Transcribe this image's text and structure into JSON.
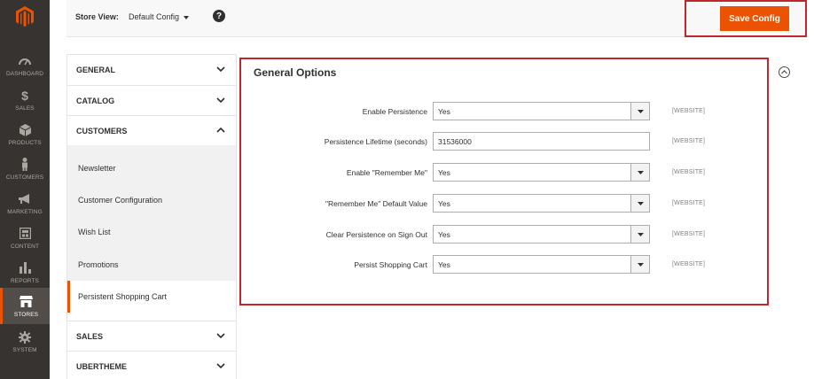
{
  "nav": {
    "items": [
      {
        "label": "DASHBOARD",
        "icon": "dashboard-icon"
      },
      {
        "label": "SALES",
        "icon": "dollar-icon"
      },
      {
        "label": "PRODUCTS",
        "icon": "cube-icon"
      },
      {
        "label": "CUSTOMERS",
        "icon": "person-icon"
      },
      {
        "label": "MARKETING",
        "icon": "megaphone-icon"
      },
      {
        "label": "CONTENT",
        "icon": "content-icon"
      },
      {
        "label": "REPORTS",
        "icon": "bar-chart-icon"
      },
      {
        "label": "STORES",
        "icon": "store-icon"
      },
      {
        "label": "SYSTEM",
        "icon": "gear-icon"
      }
    ],
    "active": "STORES"
  },
  "topbar": {
    "store_view_label": "Store View:",
    "store_view_value": "Default Config",
    "help_icon": "?",
    "save_label": "Save Config"
  },
  "tabs": {
    "groups": [
      {
        "label": "GENERAL"
      },
      {
        "label": "CATALOG"
      },
      {
        "label": "CUSTOMERS"
      },
      {
        "label": "SALES"
      },
      {
        "label": "UBERTHEME"
      }
    ],
    "customers_items": [
      {
        "label": "Newsletter"
      },
      {
        "label": "Customer Configuration"
      },
      {
        "label": "Wish List"
      },
      {
        "label": "Promotions"
      },
      {
        "label": "Persistent Shopping Cart"
      }
    ],
    "active_item": "Persistent Shopping Cart"
  },
  "section": {
    "title": "General Options",
    "rows": [
      {
        "label": "Enable Persistence",
        "type": "select",
        "value": "Yes",
        "scope": "[WEBSITE]"
      },
      {
        "label": "Persistence Lifetime (seconds)",
        "type": "text",
        "value": "31536000",
        "scope": "[WEBSITE]"
      },
      {
        "label": "Enable \"Remember Me\"",
        "type": "select",
        "value": "Yes",
        "scope": "[WEBSITE]"
      },
      {
        "label": "\"Remember Me\" Default Value",
        "type": "select",
        "value": "Yes",
        "scope": "[WEBSITE]"
      },
      {
        "label": "Clear Persistence on Sign Out",
        "type": "select",
        "value": "Yes",
        "scope": "[WEBSITE]"
      },
      {
        "label": "Persist Shopping Cart",
        "type": "select",
        "value": "Yes",
        "scope": "[WEBSITE]"
      }
    ]
  },
  "colors": {
    "accent": "#eb5202",
    "highlight_frame": "#c0272d",
    "nav_bg": "#373330"
  }
}
